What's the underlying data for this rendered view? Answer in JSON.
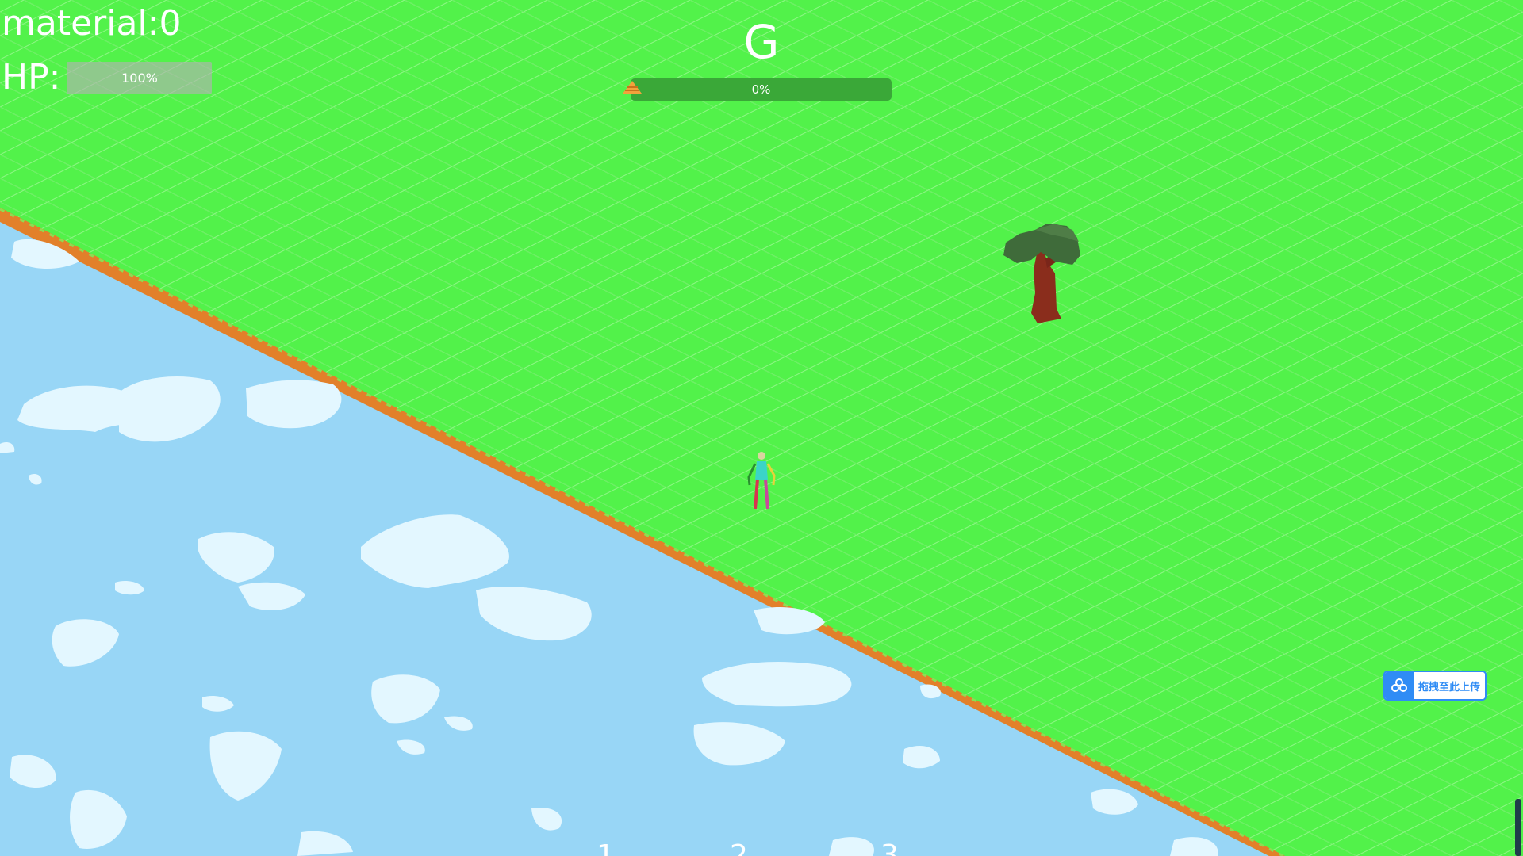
{
  "hud": {
    "material_label": "material:0",
    "hp_label": "HP:",
    "hp_value": 1.0,
    "hp_text": "100%"
  },
  "wave": {
    "letter": "G",
    "progress_value": 0.0,
    "progress_text": "0%"
  },
  "hotbar": {
    "slots": [
      "1",
      "2",
      "3"
    ]
  },
  "upload_widget": {
    "label": "拖拽至此上传",
    "icon": "cloud-share-icon"
  },
  "colors": {
    "grass": "#52f24a",
    "grass_grid": "#8ef785",
    "water": "#98d6f6",
    "clouds": "#e3f7ff",
    "dirt_edge": "#e2802a",
    "tree_canopy": "#3f6b3a",
    "tree_trunk": "#8a2d1c",
    "progress_bg": "#3aa838",
    "progress_marker": "#f2a23c",
    "upload_accent": "#2f8cf5"
  },
  "icons": {
    "progress_marker": "triangle-warning-icon"
  }
}
